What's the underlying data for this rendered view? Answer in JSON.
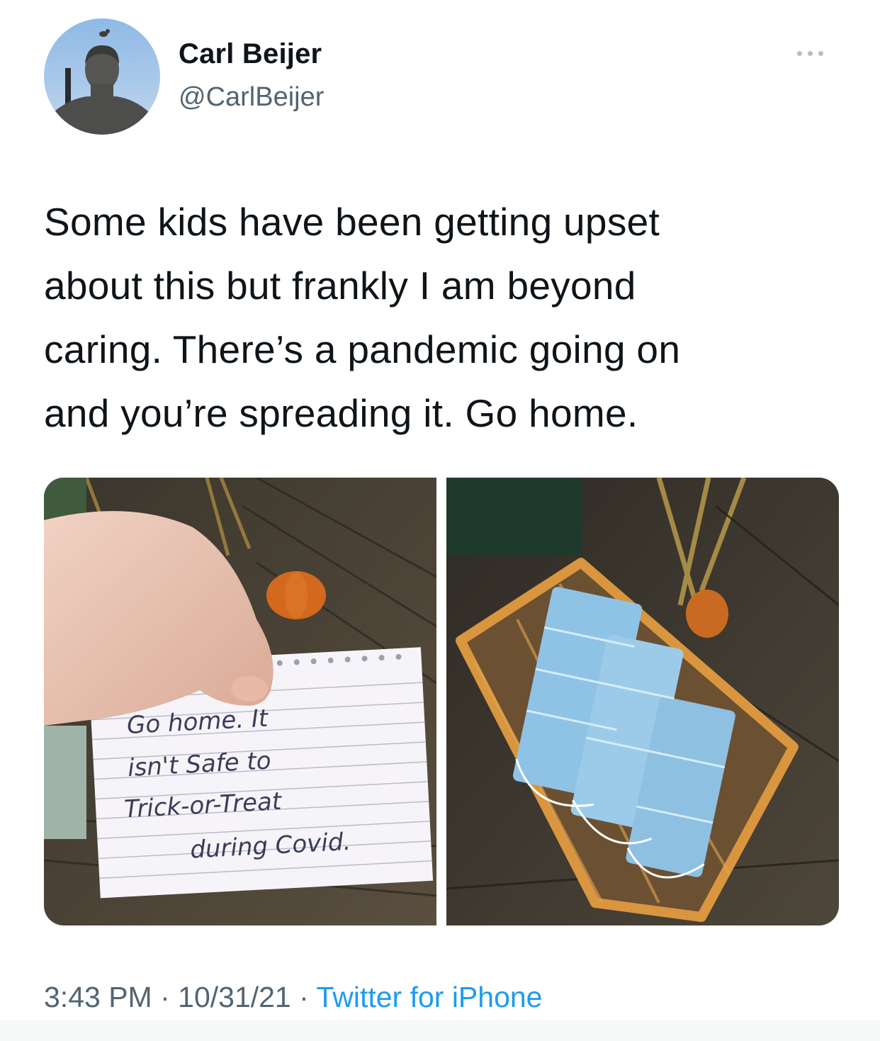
{
  "author": {
    "name": "Carl Beijer",
    "handle": "@CarlBeijer"
  },
  "tweet": {
    "lines": [
      "Some kids have been getting upset",
      "about this but frankly I am beyond",
      "caring. There’s a pandemic going on",
      "and you’re spreading it. Go home."
    ]
  },
  "media": {
    "note_lines": [
      "Go home. It",
      "isn't Safe to",
      "Trick-or-Treat",
      "during Covid."
    ]
  },
  "meta": {
    "time": "3:43 PM",
    "separator": " · ",
    "date": "10/31/21",
    "source": "Twitter for iPhone"
  },
  "icons": {
    "more": "more-options-icon"
  },
  "colors": {
    "link": "#1d9bf0",
    "secondary_text": "#536471",
    "mask_blue": "#8fc3e6",
    "basket_orange": "#d9963f"
  }
}
